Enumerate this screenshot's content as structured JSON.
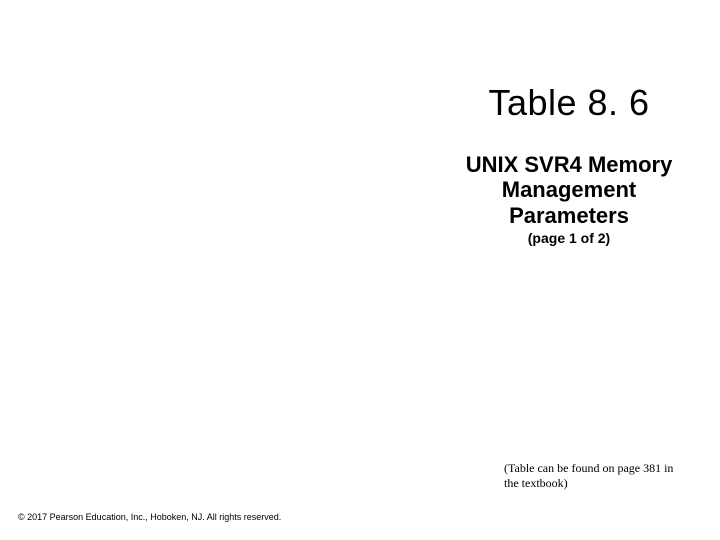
{
  "title_block": {
    "table_number": "Table 8. 6",
    "subtitle": "UNIX SVR4 Memory Management Parameters",
    "page_info": "(page 1 of 2)"
  },
  "note": "(Table can be found on page 381 in the textbook)",
  "copyright": "© 2017 Pearson Education, Inc., Hoboken, NJ. All rights reserved."
}
